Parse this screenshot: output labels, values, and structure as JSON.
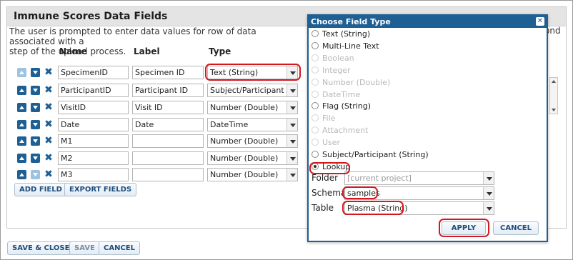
{
  "panel": {
    "title": "Immune Scores Data Fields",
    "description": "The user is prompted to enter data values for row of data associated with a",
    "description_line2": "step of the upload process.",
    "description_tail": "ond"
  },
  "columns": {
    "name": "Name",
    "label": "Label",
    "type": "Type"
  },
  "fields": [
    {
      "name": "SpecimenID",
      "label": "Specimen ID",
      "type": "Text (String)",
      "up_disabled": true,
      "down_disabled": false
    },
    {
      "name": "ParticipantID",
      "label": "Participant ID",
      "type": "Subject/Participant (Str",
      "up_disabled": false,
      "down_disabled": false
    },
    {
      "name": "VisitID",
      "label": "Visit ID",
      "type": "Number (Double)",
      "up_disabled": false,
      "down_disabled": false
    },
    {
      "name": "Date",
      "label": "Date",
      "type": "DateTime",
      "up_disabled": false,
      "down_disabled": false
    },
    {
      "name": "M1",
      "label": "",
      "type": "Number (Double)",
      "up_disabled": false,
      "down_disabled": false
    },
    {
      "name": "M2",
      "label": "",
      "type": "Number (Double)",
      "up_disabled": false,
      "down_disabled": false
    },
    {
      "name": "M3",
      "label": "",
      "type": "Number (Double)",
      "up_disabled": false,
      "down_disabled": true
    }
  ],
  "buttons": {
    "add_field": "ADD FIELD",
    "export_fields": "EXPORT FIELDS"
  },
  "footer": {
    "save_close": "SAVE & CLOSE",
    "save": "SAVE",
    "cancel": "CANCEL"
  },
  "dialog": {
    "title": "Choose Field Type",
    "options": [
      {
        "label": "Text (String)",
        "enabled": true,
        "selected": false
      },
      {
        "label": "Multi-Line Text",
        "enabled": true,
        "selected": false
      },
      {
        "label": "Boolean",
        "enabled": false,
        "selected": false
      },
      {
        "label": "Integer",
        "enabled": false,
        "selected": false
      },
      {
        "label": "Number (Double)",
        "enabled": false,
        "selected": false
      },
      {
        "label": "DateTime",
        "enabled": false,
        "selected": false
      },
      {
        "label": "Flag (String)",
        "enabled": true,
        "selected": false
      },
      {
        "label": "File",
        "enabled": false,
        "selected": false
      },
      {
        "label": "Attachment",
        "enabled": false,
        "selected": false
      },
      {
        "label": "User",
        "enabled": false,
        "selected": false
      },
      {
        "label": "Subject/Participant (String)",
        "enabled": true,
        "selected": false
      },
      {
        "label": "Lookup",
        "enabled": true,
        "selected": true
      }
    ],
    "folder_label": "Folder",
    "folder_value": "[current project]",
    "schema_label": "Schema",
    "schema_value": "samples",
    "table_label": "Table",
    "table_value": "Plasma (String)",
    "apply": "APPLY",
    "cancel": "CANCEL"
  },
  "colors": {
    "accent": "#1e5f94",
    "highlight": "#d3181f"
  }
}
